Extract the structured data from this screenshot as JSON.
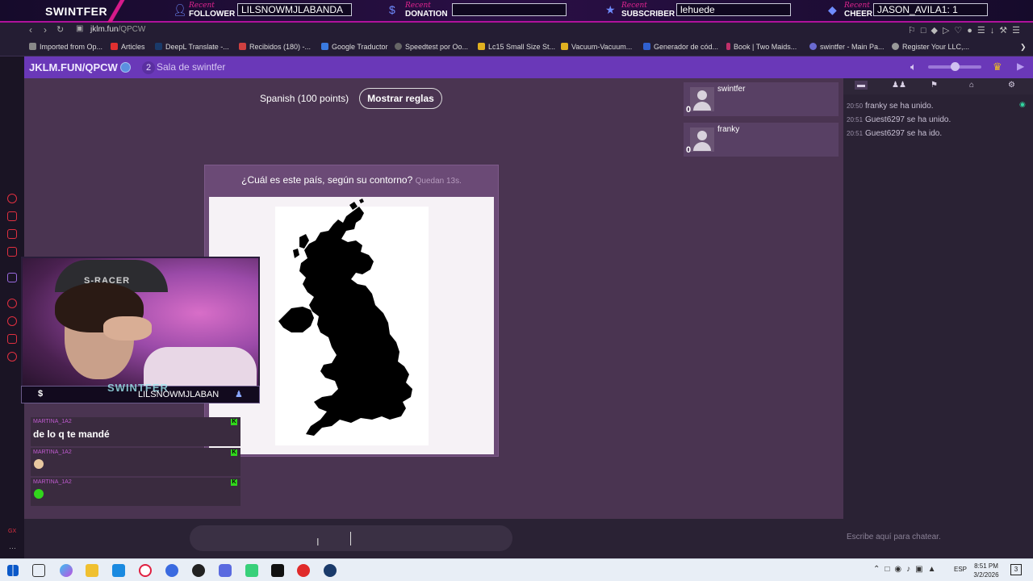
{
  "overlay": {
    "brand": "SWINTFER",
    "recent_label": "Recent",
    "follower": {
      "kind": "FOLLOWER",
      "value": "LILSNOWMJLABANDA"
    },
    "donation": {
      "kind": "DONATION",
      "value": ""
    },
    "subscriber": {
      "kind": "SUBSCRIBER",
      "value": "lehuede"
    },
    "cheer": {
      "kind": "CHEER",
      "value": "JASON_AVILA1: 1"
    }
  },
  "browser": {
    "url_host": "jklm.fun",
    "url_path": "/QPCW",
    "bookmarks": [
      "Imported from Op...",
      "Articles",
      "DeepL Translate -...",
      "Recibidos (180) -...",
      "Google Traductor",
      "Speedtest por Oo...",
      "Lc15 Small Size St...",
      "Vacuum-Vacuum...",
      "Generador de cód...",
      "Book | Two Maids...",
      "swintfer - Main Pa...",
      "Register Your LLC,..."
    ]
  },
  "site": {
    "room_url": "JKLM.FUN/QPCW",
    "room_number": "2",
    "room_name": "Sala de swintfer"
  },
  "game": {
    "language": "Spanish (100 points)",
    "rules_button": "Mostrar reglas",
    "question": "¿Cuál es este país, según su contorno?",
    "timer": "Quedan 13s."
  },
  "stream_chat": [
    {
      "user": "MARTINA_1A2",
      "message": "de lo q te mandé",
      "badge": "K"
    },
    {
      "user": "MARTINA_1A2",
      "message": "",
      "badge": "K",
      "emote_color": "#e8c8a0"
    },
    {
      "user": "MARTINA_1A2",
      "message": "",
      "badge": "K",
      "emote_color": "#31d61c"
    }
  ],
  "webcam": {
    "chair_text": "S-RACER",
    "watermark": "SWINTFER",
    "ticker": "LILSNOWMJLABAN",
    "ticker_icon": "$"
  },
  "players": [
    {
      "name": "swintfer",
      "score": "0"
    },
    {
      "name": "franky",
      "score": "0"
    }
  ],
  "chat_log": [
    {
      "time": "20:50",
      "text": "franky se ha unido."
    },
    {
      "time": "20:51",
      "text": "Guest6297 se ha unido."
    },
    {
      "time": "20:51",
      "text": "Guest6297 se ha ido."
    }
  ],
  "chat_placeholder": "Escribe aquí para chatear.",
  "taskbar": {
    "language": "ESP",
    "time": "8:51 PM",
    "date": "3/2/2026",
    "notifications": "3"
  },
  "colors": {
    "header_purple": "#6a38b8",
    "game_bg": "#4a3451",
    "accent_pink": "#d61a8a",
    "kick_green": "#31d61c"
  }
}
